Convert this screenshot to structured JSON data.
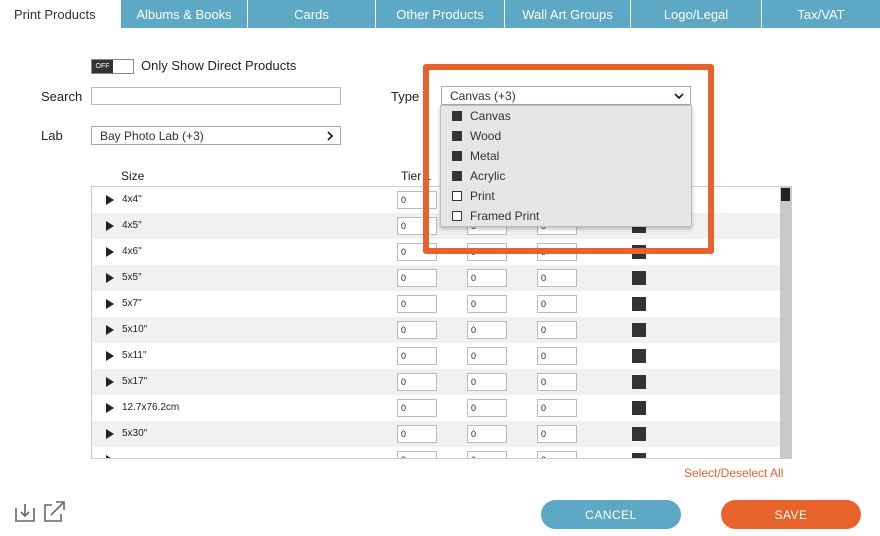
{
  "tabs": [
    {
      "label": "Print Products",
      "active": true
    },
    {
      "label": "Albums & Books"
    },
    {
      "label": "Cards"
    },
    {
      "label": "Other Products"
    },
    {
      "label": "Wall Art Groups"
    },
    {
      "label": "Logo/Legal"
    },
    {
      "label": "Tax/VAT"
    }
  ],
  "filters": {
    "toggle_state": "OFF",
    "toggle_label": "Only Show Direct Products",
    "search_label": "Search",
    "search_value": "",
    "type_label": "Type",
    "type_value": "Canvas (+3)",
    "lab_label": "Lab",
    "lab_value": "Bay Photo Lab (+3)"
  },
  "type_options": [
    {
      "label": "Canvas",
      "checked": true
    },
    {
      "label": "Wood",
      "checked": true
    },
    {
      "label": "Metal",
      "checked": true
    },
    {
      "label": "Acrylic",
      "checked": true
    },
    {
      "label": "Print",
      "checked": false
    },
    {
      "label": "Framed Print",
      "checked": false
    }
  ],
  "table": {
    "headers": {
      "size": "Size",
      "tier1": "Tier 1"
    },
    "rows": [
      {
        "size": "4x4\"",
        "t1": "0",
        "t2": "0",
        "t3": "0"
      },
      {
        "size": "4x5\"",
        "t1": "0",
        "t2": "0",
        "t3": "0"
      },
      {
        "size": "4x6\"",
        "t1": "0",
        "t2": "0",
        "t3": "0"
      },
      {
        "size": "5x5\"",
        "t1": "0",
        "t2": "0",
        "t3": "0"
      },
      {
        "size": "5x7\"",
        "t1": "0",
        "t2": "0",
        "t3": "0"
      },
      {
        "size": "5x10\"",
        "t1": "0",
        "t2": "0",
        "t3": "0"
      },
      {
        "size": "5x11\"",
        "t1": "0",
        "t2": "0",
        "t3": "0"
      },
      {
        "size": "5x17\"",
        "t1": "0",
        "t2": "0",
        "t3": "0"
      },
      {
        "size": "12.7x76.2cm",
        "t1": "0",
        "t2": "0",
        "t3": "0"
      },
      {
        "size": "5x30\"",
        "t1": "0",
        "t2": "0",
        "t3": "0"
      },
      {
        "size": "",
        "t1": "0",
        "t2": "0",
        "t3": "0"
      }
    ]
  },
  "select_all_label": "Select/Deselect All",
  "buttons": {
    "cancel": "CANCEL",
    "save": "SAVE"
  },
  "icons": {
    "import": "import-icon",
    "export": "external-link-icon"
  },
  "colors": {
    "tab": "#5da8c4",
    "accent": "#e8622c"
  }
}
